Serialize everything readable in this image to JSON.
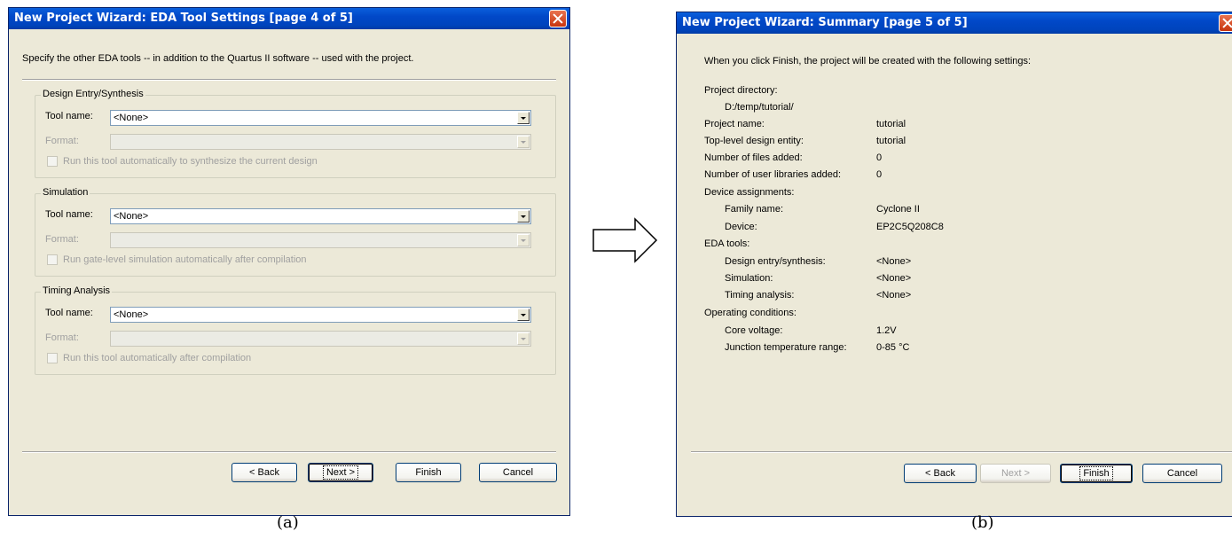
{
  "dialog_a": {
    "title": "New Project Wizard: EDA Tool Settings [page 4 of 5]",
    "intro": "Specify the other EDA tools -- in addition to the Quartus II software -- used with the project.",
    "groups": [
      {
        "legend": "Design Entry/Synthesis",
        "tool_label": "Tool name:",
        "tool_value": "<None>",
        "format_label": "Format:",
        "checkbox_label": "Run this tool automatically to synthesize the current design"
      },
      {
        "legend": "Simulation",
        "tool_label": "Tool name:",
        "tool_value": "<None>",
        "format_label": "Format:",
        "checkbox_label": "Run gate-level simulation automatically after compilation"
      },
      {
        "legend": "Timing Analysis",
        "tool_label": "Tool name:",
        "tool_value": "<None>",
        "format_label": "Format:",
        "checkbox_label": "Run this tool automatically after compilation"
      }
    ],
    "buttons": {
      "back": "< Back",
      "next": "Next >",
      "finish": "Finish",
      "cancel": "Cancel"
    },
    "caption": "(a)"
  },
  "dialog_b": {
    "title": "New Project Wizard: Summary [page 5 of 5]",
    "intro": "When you click Finish, the project will be created with the following settings:",
    "rows": {
      "project_directory_label": "Project directory:",
      "project_directory_value": "D:/temp/tutorial/",
      "project_name_label": "Project name:",
      "project_name_value": "tutorial",
      "top_level_label": "Top-level design entity:",
      "top_level_value": "tutorial",
      "files_added_label": "Number of files added:",
      "files_added_value": "0",
      "user_libs_label": "Number of user libraries added:",
      "user_libs_value": "0",
      "device_assign_label": "Device assignments:",
      "family_label": "Family name:",
      "family_value": "Cyclone II",
      "device_label": "Device:",
      "device_value": "EP2C5Q208C8",
      "eda_tools_label": "EDA tools:",
      "design_entry_label": "Design entry/synthesis:",
      "design_entry_value": "<None>",
      "simulation_label": "Simulation:",
      "simulation_value": "<None>",
      "timing_label": "Timing analysis:",
      "timing_value": "<None>",
      "operating_label": "Operating conditions:",
      "core_voltage_label": "Core voltage:",
      "core_voltage_value": "1.2V",
      "junction_label": "Junction temperature range:",
      "junction_value": "0-85 °C"
    },
    "buttons": {
      "back": "< Back",
      "next": "Next >",
      "finish": "Finish",
      "cancel": "Cancel"
    },
    "caption": "(b)"
  }
}
